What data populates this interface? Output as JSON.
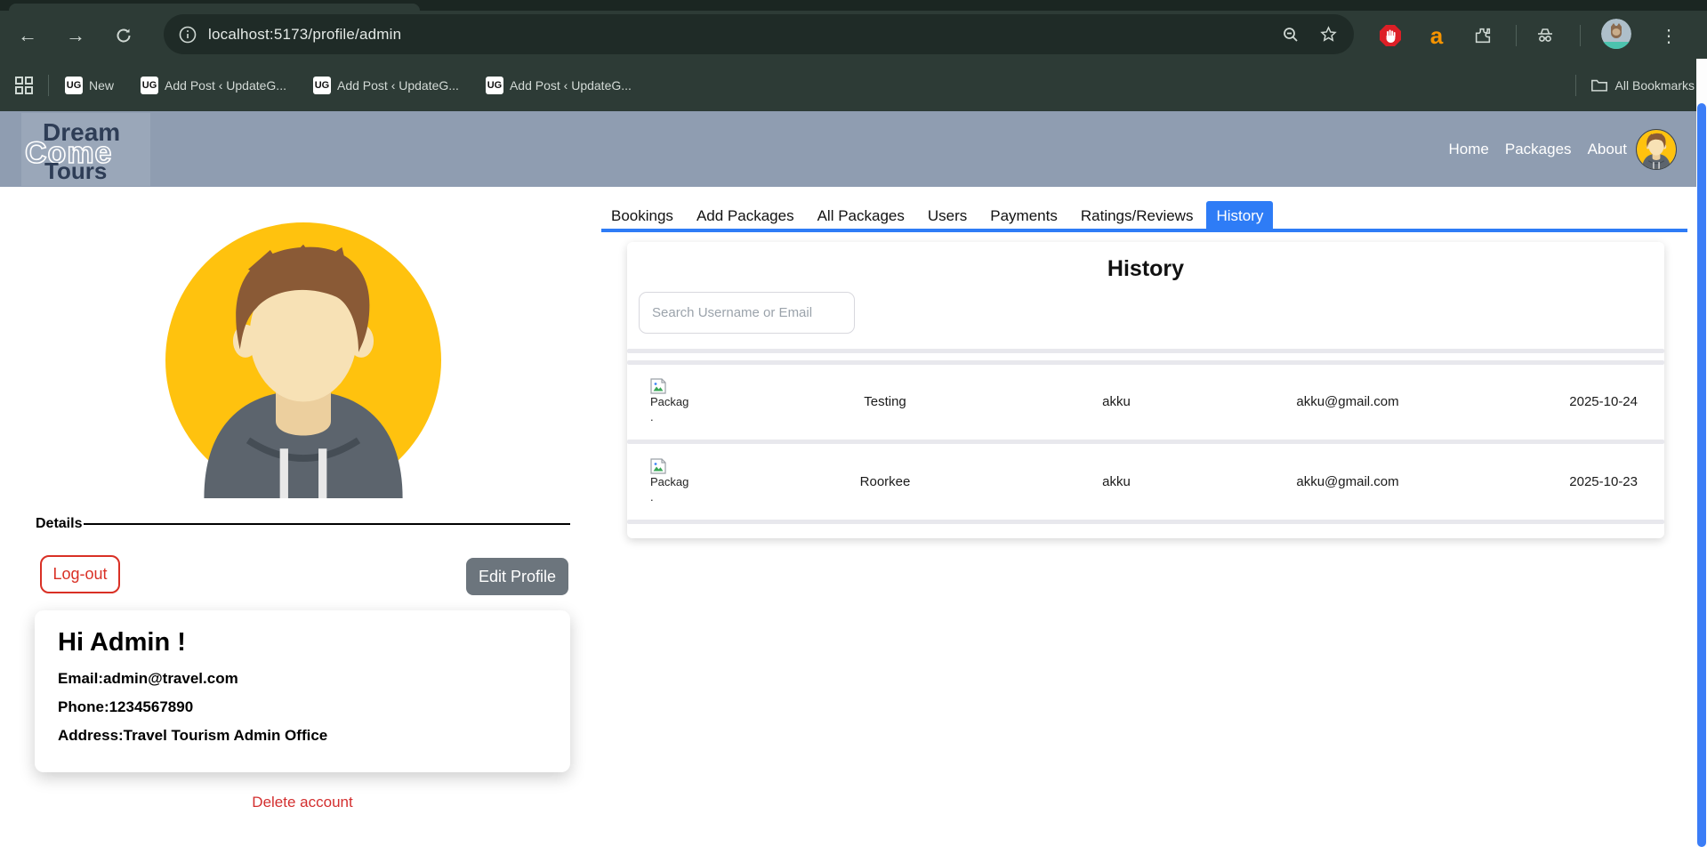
{
  "browser": {
    "url": "localhost:5173/profile/admin",
    "glyphs": {
      "back": "←",
      "forward": "→",
      "more": "⋮",
      "amazon": "a"
    },
    "bookmarks_bar": {
      "items": [
        {
          "favicon": "UG",
          "label": "New"
        },
        {
          "favicon": "UG",
          "label": "Add Post ‹ UpdateG..."
        },
        {
          "favicon": "UG",
          "label": "Add Post ‹ UpdateG..."
        },
        {
          "favicon": "UG",
          "label": "Add Post ‹ UpdateG..."
        }
      ],
      "all_bookmarks_label": "All Bookmarks"
    }
  },
  "site_header": {
    "logo": {
      "line1": "Dream",
      "line2": "Come",
      "line3": "Tours"
    },
    "nav": [
      {
        "label": "Home"
      },
      {
        "label": "Packages"
      },
      {
        "label": "About"
      }
    ]
  },
  "profile": {
    "details_label": "Details",
    "logout_label": "Log-out",
    "edit_profile_label": "Edit Profile",
    "greeting": "Hi Admin !",
    "email_line": "Email:admin@travel.com",
    "phone_line": "Phone:1234567890",
    "address_line": "Address:Travel Tourism Admin Office",
    "delete_label": "Delete account"
  },
  "admin_tabs": {
    "active": "History",
    "items": [
      {
        "label": "Bookings"
      },
      {
        "label": "Add Packages"
      },
      {
        "label": "All Packages"
      },
      {
        "label": "Users"
      },
      {
        "label": "Payments"
      },
      {
        "label": "Ratings/Reviews"
      },
      {
        "label": "History"
      }
    ]
  },
  "history_panel": {
    "title": "History",
    "search_placeholder": "Search Username or Email",
    "rows": [
      {
        "image_alt_line1": "Packag",
        "image_alt_line2": ".",
        "package": "Testing",
        "username": "akku",
        "email": "akku@gmail.com",
        "date": "2025-10-24"
      },
      {
        "image_alt_line1": "Packag",
        "image_alt_line2": ".",
        "package": "Roorkee",
        "username": "akku",
        "email": "akku@gmail.com",
        "date": "2025-10-23"
      }
    ]
  },
  "colors": {
    "accent_blue": "#2e7cf6",
    "danger_red": "#d93025",
    "header_blue_gray": "#8f9db1",
    "chrome_dark": "#2d3b36",
    "edit_button_gray": "#6c757d",
    "avatar_yellow": "#ffc20e"
  }
}
